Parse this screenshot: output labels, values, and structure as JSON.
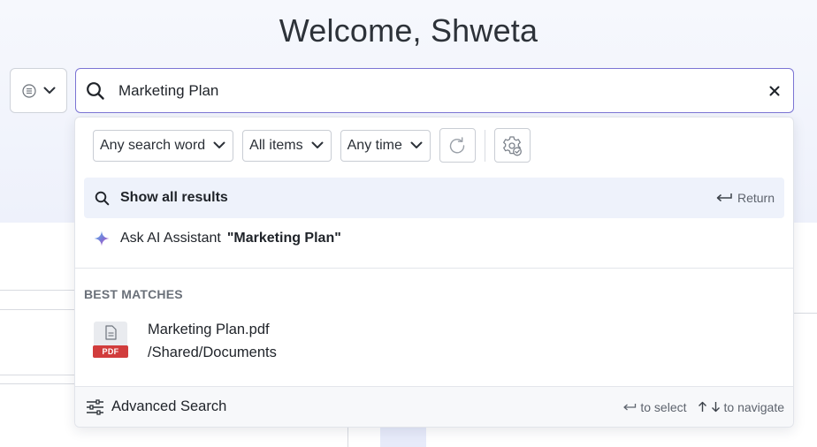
{
  "header": {
    "welcome": "Welcome, Shweta"
  },
  "search": {
    "value": "Marketing Plan",
    "placeholder": "",
    "scope_icon": "list-icon",
    "accent_color": "#7b74d4"
  },
  "filters": {
    "match_mode": "Any search word",
    "item_type": "All items",
    "time_range": "Any time"
  },
  "show_all": {
    "label": "Show all results",
    "hint": "Return"
  },
  "ask_ai": {
    "label": "Ask AI Assistant",
    "query": "\"Marketing Plan\""
  },
  "best_matches": {
    "heading": "BEST MATCHES",
    "items": [
      {
        "name": "Marketing Plan.pdf",
        "path": "/Shared/Documents",
        "type_badge": "PDF",
        "badge_color": "#d13c3c"
      }
    ]
  },
  "footer": {
    "advanced_search": "Advanced Search",
    "select_hint": "to select",
    "navigate_hint": "to navigate"
  }
}
